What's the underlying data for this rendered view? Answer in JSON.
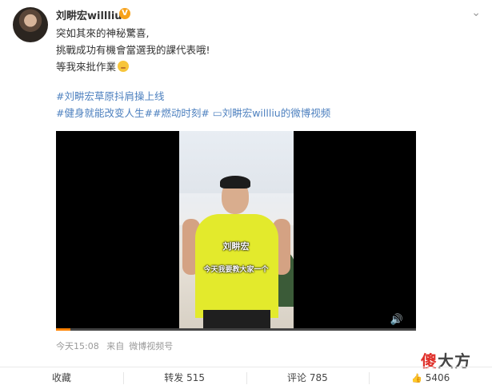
{
  "post": {
    "username": "刘畊宏willliu",
    "verified_icon": "verified-badge-icon",
    "menu_icon": "chevron-down-icon",
    "text_lines": [
      "突如其來的神秘驚喜,",
      "挑戰成功有機會當選我的課代表哦!",
      "等我來批作業"
    ],
    "hashtag_1": "#刘畊宏草原抖肩操上线",
    "hashtag_2": "#健身就能改变人生#",
    "hashtag_3": "#燃动时刻#",
    "video_link": "▭刘畊宏willliu的微博视频",
    "emoji": "smirk-emoji-icon"
  },
  "video": {
    "caption_name": "刘畊宏",
    "caption_line": "今天我要教大家一个",
    "volume_icon": "volume-icon",
    "progress": 0.04
  },
  "meta": {
    "time": "今天15:08",
    "source_prefix": "来自",
    "source": "微博视频号"
  },
  "watermark": {
    "char1": "傻",
    "char2": "大方"
  },
  "actions": {
    "favorite": "收藏",
    "repost": "转发 515",
    "comment": "评论 785",
    "like_icon": "thumbs-up-icon",
    "like": "5406"
  }
}
